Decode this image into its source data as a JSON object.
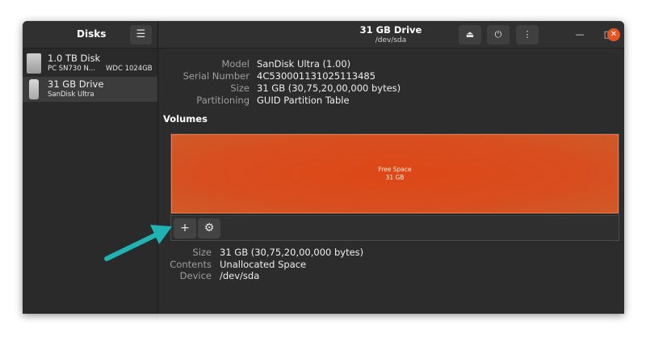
{
  "sidebar": {
    "title": "Disks",
    "menu_icon": "hamburger-menu-icon",
    "disks": [
      {
        "name": "1.0 TB Disk",
        "model": "PC SN730 N...",
        "model2": "WDC 1024GB",
        "icon": "hard-disk-icon",
        "selected": false
      },
      {
        "name": "31 GB Drive",
        "model": "SanDisk Ultra",
        "model2": "",
        "icon": "usb-drive-icon",
        "selected": true
      }
    ]
  },
  "header": {
    "title": "31 GB Drive",
    "subtitle": "/dev/sda",
    "eject_icon": "eject-icon",
    "power_icon": "power-icon",
    "more_icon": "more-vertical-icon",
    "minimize": "—",
    "maximize": "□",
    "close": "✕"
  },
  "drive_info": [
    {
      "label": "Model",
      "value": "SanDisk Ultra (1.00)"
    },
    {
      "label": "Serial Number",
      "value": "4C530001131025113485"
    },
    {
      "label": "Size",
      "value": "31 GB (30,75,20,00,000 bytes)"
    },
    {
      "label": "Partitioning",
      "value": "GUID Partition Table"
    }
  ],
  "volumes": {
    "title": "Volumes",
    "bar_label": "Free Space",
    "bar_size": "31 GB",
    "add_label": "+",
    "settings_icon": "gear-icon"
  },
  "volume_info": [
    {
      "label": "Size",
      "value": "31 GB (30,75,20,00,000 bytes)"
    },
    {
      "label": "Contents",
      "value": "Unallocated Space"
    },
    {
      "label": "Device",
      "value": "/dev/sda"
    }
  ],
  "colors": {
    "accent": "#e95420",
    "free_space": "#dc4c1c",
    "annotation_arrow": "#1fb3b3"
  }
}
